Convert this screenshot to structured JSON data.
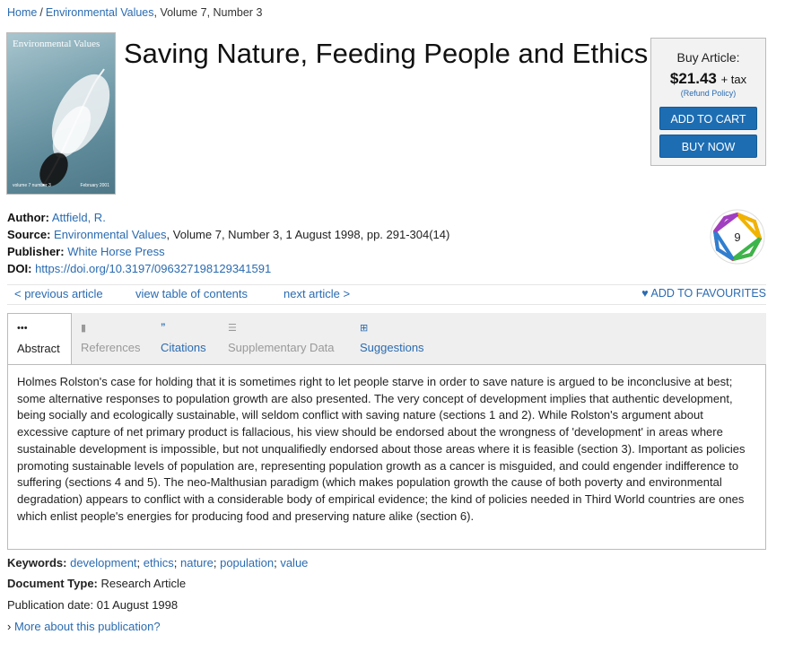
{
  "breadcrumb": {
    "home": "Home",
    "sep": "/",
    "journal": "Environmental Values",
    "issue": ", Volume 7, Number 3"
  },
  "cover": {
    "title": "Environmental Values",
    "foot_left": "volume 7 number 3",
    "foot_right": "February 2001"
  },
  "article": {
    "title": "Saving Nature, Feeding People and Ethics"
  },
  "buy": {
    "label": "Buy Article:",
    "price": "$21.43",
    "tax": "+ tax",
    "refund": "(Refund Policy)",
    "add_to_cart": "ADD TO CART",
    "buy_now": "BUY NOW"
  },
  "meta": {
    "author_label": "Author:",
    "author": "Attfield, R.",
    "source_label": "Source:",
    "source_journal": "Environmental Values",
    "source_rest": ", Volume 7, Number 3, 1 August 1998, pp. 291-304(14)",
    "publisher_label": "Publisher:",
    "publisher": "White Horse Press",
    "doi_label": "DOI:",
    "doi": "https://doi.org/10.3197/096327198129341591"
  },
  "badge": {
    "count": "9"
  },
  "nav": {
    "prev": "< previous article",
    "toc": "view table of contents",
    "next": "next article >",
    "fav": "ADD TO FAVOURITES"
  },
  "tabs": [
    {
      "label": "Abstract",
      "icon": "ellipsis-icon"
    },
    {
      "label": "References",
      "icon": "bookmark-icon"
    },
    {
      "label": "Citations",
      "icon": "quote-icon"
    },
    {
      "label": "Supplementary Data",
      "icon": "list-icon"
    },
    {
      "label": "Suggestions",
      "icon": "plus-square-icon"
    }
  ],
  "abstract": "Holmes Rolston's case for holding that it is sometimes right to let people starve in order to save nature is argued to be inconclusive at best; some alternative responses to population growth are also presented. The very concept of development implies that authentic development, being socially and ecologically sustainable, will seldom conflict with saving nature (sections 1 and 2). While Rolston's argument about excessive capture of net primary product is fallacious, his view should be endorsed about the wrongness of 'development' in areas where sustainable development is impossible, but not unqualifiedly endorsed about those areas where it is feasible (section 3). Important as policies promoting sustainable levels of population are, representing population growth as a cancer is misguided, and could engender indifference to suffering (sections 4 and 5). The neo-Malthusian paradigm (which makes population growth the cause of both poverty and environmental degradation) appears to conflict with a considerable body of empirical evidence; the kind of policies needed in Third World countries are ones which enlist people's energies for producing food and preserving nature alike (section 6).",
  "keywords": {
    "label": "Keywords:",
    "items": [
      "development",
      "ethics",
      "nature",
      "population",
      "value"
    ]
  },
  "doctype": {
    "label": "Document Type:",
    "value": "Research Article"
  },
  "pubdate": {
    "label": "Publication date:",
    "value": "01 August 1998"
  },
  "more": {
    "label": "More about this publication?"
  }
}
